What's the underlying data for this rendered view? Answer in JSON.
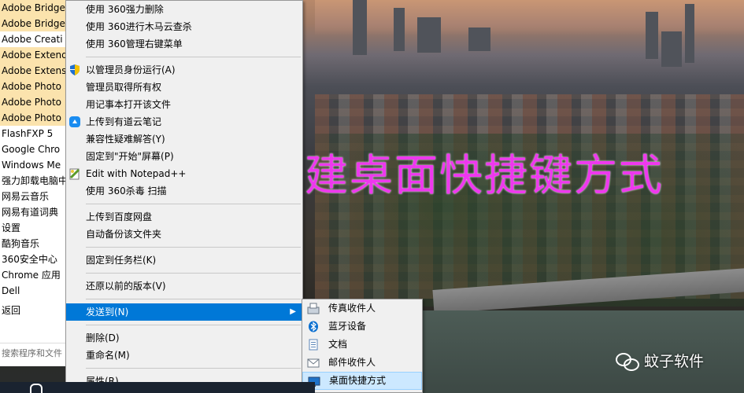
{
  "start_menu": {
    "items": [
      {
        "label": "Adobe Bridge",
        "highlighted": true
      },
      {
        "label": "Adobe Bridge",
        "highlighted": true
      },
      {
        "label": "Adobe Creati",
        "highlighted": false
      },
      {
        "label": "Adobe Extend",
        "highlighted": true
      },
      {
        "label": "Adobe Extens",
        "highlighted": true
      },
      {
        "label": "Adobe Photo",
        "highlighted": true
      },
      {
        "label": "Adobe Photo",
        "highlighted": true
      },
      {
        "label": "Adobe Photo",
        "highlighted": true
      },
      {
        "label": "FlashFXP 5",
        "highlighted": false
      },
      {
        "label": "Google Chro",
        "highlighted": false
      },
      {
        "label": "Windows Me",
        "highlighted": false
      },
      {
        "label": "强力卸载电脑中",
        "highlighted": false
      },
      {
        "label": "网易云音乐",
        "highlighted": false
      },
      {
        "label": "网易有道词典",
        "highlighted": false
      },
      {
        "label": "设置",
        "highlighted": false
      },
      {
        "label": "酷狗音乐",
        "highlighted": false
      },
      {
        "label": "360安全中心",
        "highlighted": false
      },
      {
        "label": "Chrome 应用",
        "highlighted": false
      },
      {
        "label": "Dell",
        "highlighted": false
      }
    ],
    "back_label": "返回",
    "search_placeholder": "搜索程序和文件"
  },
  "context_menu": {
    "groups": [
      [
        {
          "label": "使用 360强力删除",
          "icon": "none"
        },
        {
          "label": "使用 360进行木马云查杀",
          "icon": "none"
        },
        {
          "label": "使用 360管理右键菜单",
          "icon": "none"
        }
      ],
      [
        {
          "label": "以管理员身份运行(A)",
          "icon": "uac-shield-icon"
        },
        {
          "label": "管理员取得所有权",
          "icon": "none"
        },
        {
          "label": "用记事本打开该文件",
          "icon": "none"
        },
        {
          "label": "上传到有道云笔记",
          "icon": "youdao-note-icon"
        },
        {
          "label": "兼容性疑难解答(Y)",
          "icon": "none"
        },
        {
          "label": "固定到\"开始\"屏幕(P)",
          "icon": "none"
        },
        {
          "label": "Edit with Notepad++",
          "icon": "notepadpp-icon"
        },
        {
          "label": "使用 360杀毒 扫描",
          "icon": "none"
        }
      ],
      [
        {
          "label": "上传到百度网盘",
          "icon": "none"
        },
        {
          "label": "自动备份该文件夹",
          "icon": "none"
        }
      ],
      [
        {
          "label": "固定到任务栏(K)",
          "icon": "none"
        }
      ],
      [
        {
          "label": "还原以前的版本(V)",
          "icon": "none"
        }
      ],
      [
        {
          "label": "发送到(N)",
          "icon": "none",
          "highlighted": true,
          "submenu": true
        }
      ],
      [
        {
          "label": "删除(D)",
          "icon": "none"
        },
        {
          "label": "重命名(M)",
          "icon": "none"
        }
      ],
      [
        {
          "label": "属性(R)",
          "icon": "none"
        }
      ]
    ],
    "submenu_arrow": "▶"
  },
  "send_to_menu": {
    "items": [
      {
        "label": "传真收件人",
        "icon": "fax-icon"
      },
      {
        "label": "蓝牙设备",
        "icon": "bluetooth-icon"
      },
      {
        "label": "文档",
        "icon": "documents-icon"
      },
      {
        "label": "邮件收件人",
        "icon": "mail-icon"
      },
      {
        "label": "桌面快捷方式",
        "icon": "desktop-icon",
        "highlighted": true
      }
    ]
  },
  "overlay": {
    "title": "创建桌面快捷键方式",
    "watermark": "蚊子软件"
  },
  "colors": {
    "menu_highlight": "#0078d7",
    "start_highlight": "#fbe3ad",
    "overlay_text": "#ee38ee"
  }
}
